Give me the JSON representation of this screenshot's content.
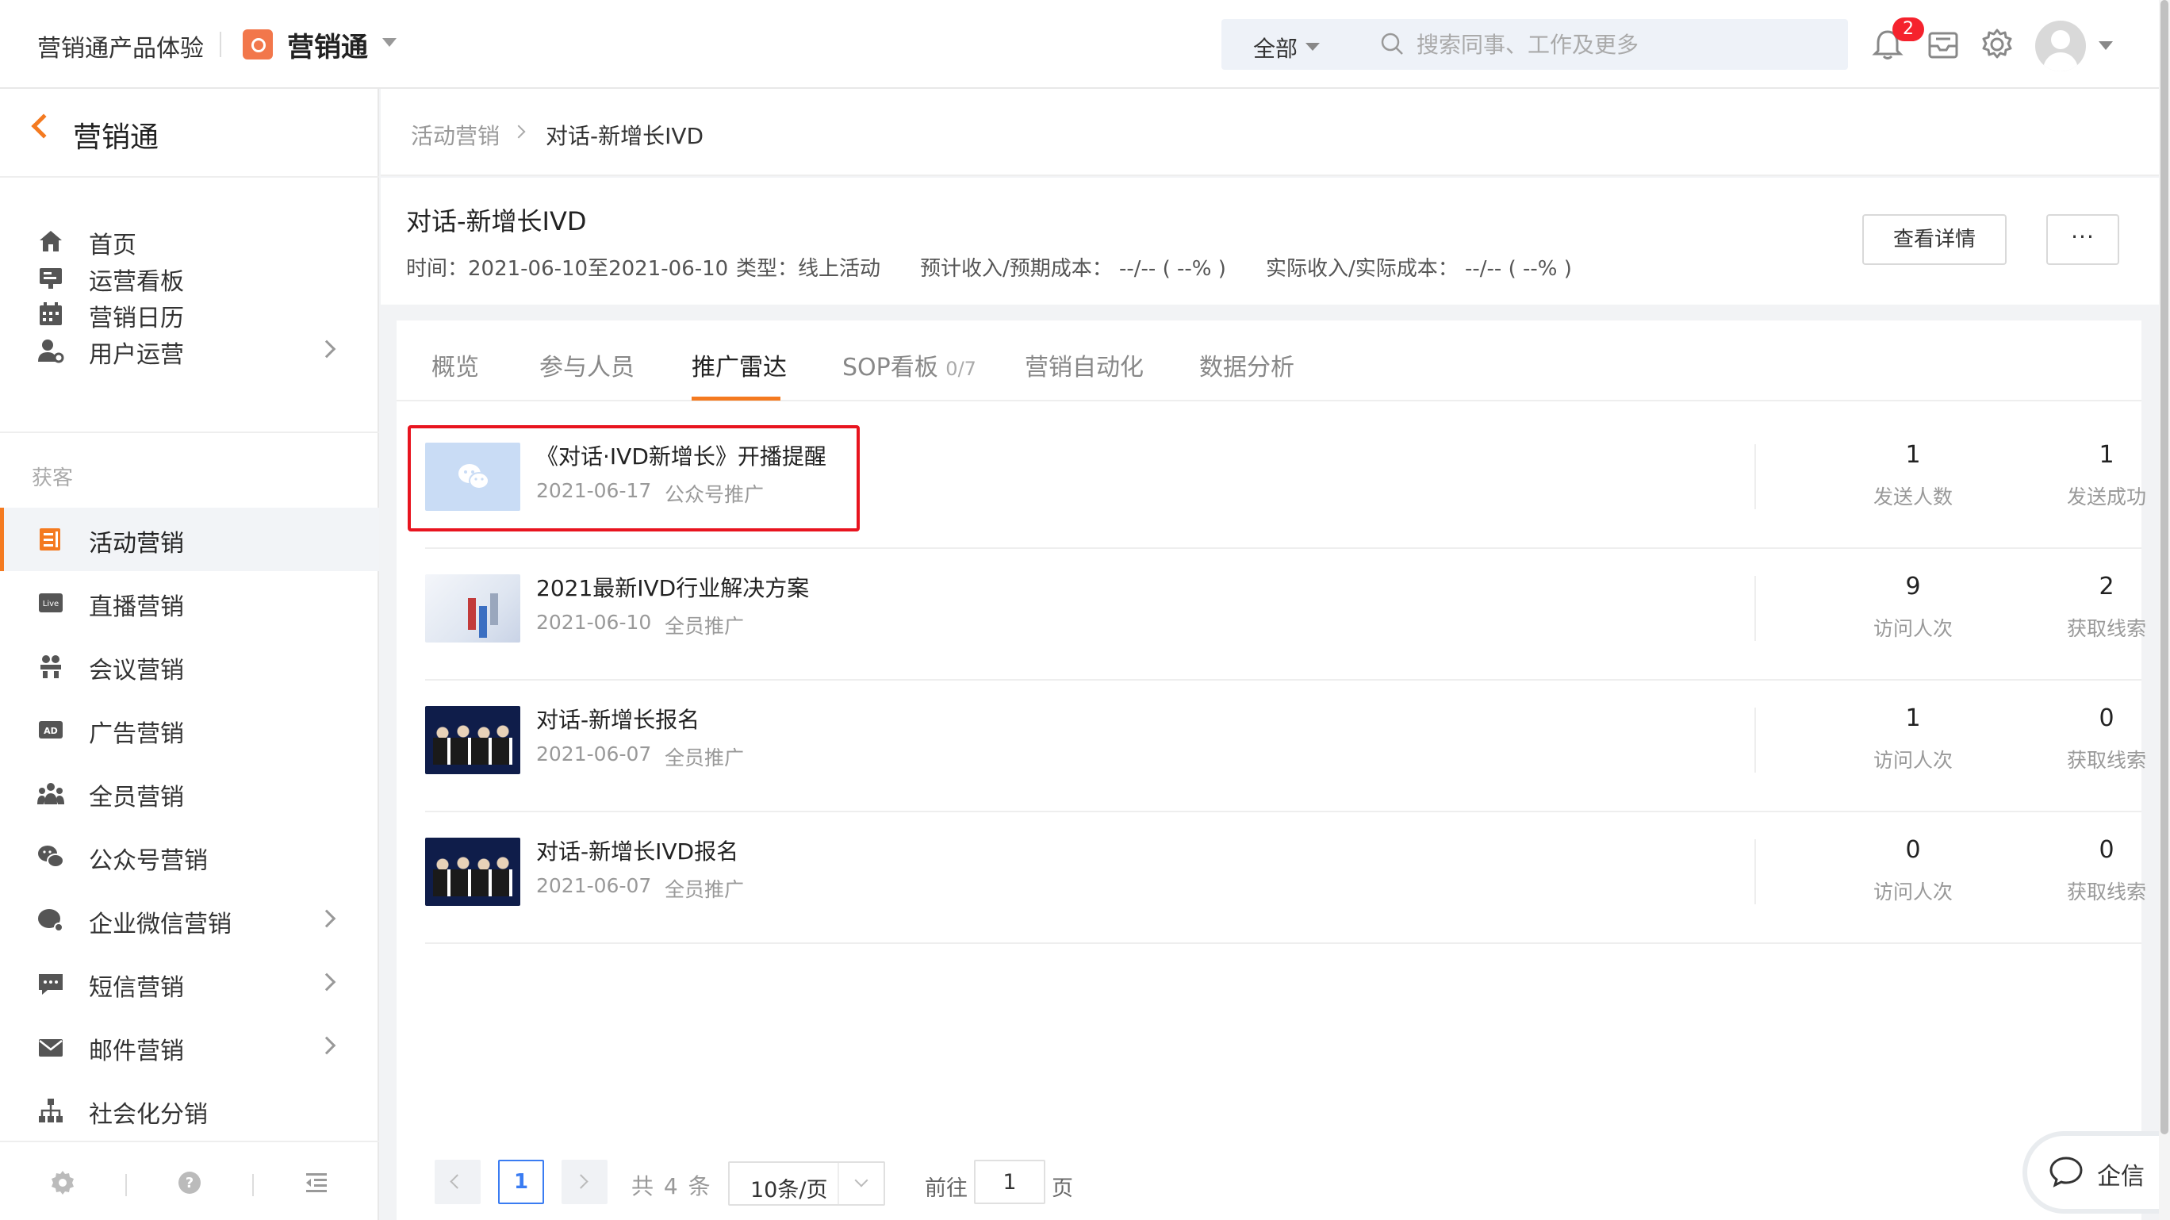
{
  "topbar": {
    "org_name": "营销通产品体验",
    "app_name": "营销通",
    "search_scope": "全部",
    "search_placeholder": "搜索同事、工作及更多",
    "notification_count": "2"
  },
  "sidebar": {
    "title": "营销通",
    "items_top": [
      {
        "label": "首页",
        "icon": "home-icon"
      },
      {
        "label": "运营看板",
        "icon": "dashboard-icon"
      },
      {
        "label": "营销日历",
        "icon": "calendar-icon"
      },
      {
        "label": "用户运营",
        "icon": "user-ops-icon",
        "has_children": true
      }
    ],
    "group_label": "获客",
    "items_group": [
      {
        "label": "活动营销",
        "icon": "activity-icon",
        "active": true
      },
      {
        "label": "直播营销",
        "icon": "live-icon"
      },
      {
        "label": "会议营销",
        "icon": "meeting-icon"
      },
      {
        "label": "广告营销",
        "icon": "ad-icon"
      },
      {
        "label": "全员营销",
        "icon": "team-icon"
      },
      {
        "label": "公众号营销",
        "icon": "wechat-icon"
      },
      {
        "label": "企业微信营销",
        "icon": "wecom-icon",
        "has_children": true
      },
      {
        "label": "短信营销",
        "icon": "sms-icon",
        "has_children": true
      },
      {
        "label": "邮件营销",
        "icon": "mail-icon",
        "has_children": true
      },
      {
        "label": "社会化分销",
        "icon": "org-tree-icon"
      }
    ]
  },
  "breadcrumb": {
    "parent": "活动营销",
    "current": "对话-新增长IVD"
  },
  "header": {
    "title": "对话-新增长IVD",
    "time": "时间：2021-06-10至2021-06-10",
    "type": "类型：线上活动",
    "expected": "预计收入/预期成本：  --/-- ( --% )",
    "actual": "实际收入/实际成本：  --/-- ( --% )",
    "detail_button": "查看详情",
    "more_button": "···"
  },
  "tabs": [
    {
      "label": "概览"
    },
    {
      "label": "参与人员"
    },
    {
      "label": "推广雷达",
      "active": true
    },
    {
      "label": "SOP看板",
      "count": "0/7"
    },
    {
      "label": "营销自动化"
    },
    {
      "label": "数据分析"
    }
  ],
  "rows": [
    {
      "title": "《对话·IVD新增长》开播提醒",
      "date": "2021-06-17",
      "type": "公众号推广",
      "thumb": "wechat",
      "stat1_value": "1",
      "stat1_label": "发送人数",
      "stat2_value": "1",
      "stat2_label": "发送成功"
    },
    {
      "title": "2021最新IVD行业解决方案",
      "date": "2021-06-10",
      "type": "全员推广",
      "thumb": "chart",
      "stat1_value": "9",
      "stat1_label": "访问人次",
      "stat2_value": "2",
      "stat2_label": "获取线索"
    },
    {
      "title": "对话-新增长报名",
      "date": "2021-06-07",
      "type": "全员推广",
      "thumb": "event",
      "stat1_value": "1",
      "stat1_label": "访问人次",
      "stat2_value": "0",
      "stat2_label": "获取线索"
    },
    {
      "title": "对话-新增长IVD报名",
      "date": "2021-06-07",
      "type": "全员推广",
      "thumb": "event",
      "stat1_value": "0",
      "stat1_label": "访问人次",
      "stat2_value": "0",
      "stat2_label": "获取线索"
    }
  ],
  "pagination": {
    "current": "1",
    "total": "共 4 条",
    "page_size": "10条/页",
    "goto_label": "前往",
    "goto_value": "1",
    "page_label": "页"
  },
  "float_widget": {
    "label": "企信"
  },
  "colors": {
    "accent": "#f47a20",
    "highlight": "#e8141f",
    "link": "#3a7cf2"
  }
}
